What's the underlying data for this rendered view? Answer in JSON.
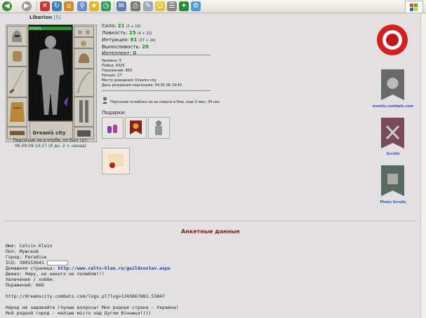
{
  "browser": {
    "toolbar_icons": [
      "back-icon",
      "forward-icon",
      "stop-icon",
      "refresh-icon",
      "home-icon",
      "search-icon",
      "favorites-icon",
      "history-icon",
      "mail-icon",
      "print-icon",
      "edit-icon",
      "messenger-icon",
      "research-icon",
      "bluetooth-icon"
    ]
  },
  "character": {
    "name": "Liberion",
    "level_tag": "[5]",
    "hp": "373/373",
    "city": "Dreams city",
    "location_line": "Персонаж не в клубе, но был тут:",
    "last_seen": "06.09.09 14:27 (4 дн. 2 ч. назад)"
  },
  "stats": {
    "strength_label": "Сила:",
    "strength_value": "21",
    "strength_bonus": "(5 + 16)",
    "agility_label": "Ловкость:",
    "agility_value": "25",
    "agility_bonus": "(4 + 21)",
    "intuition_label": "Интуиция:",
    "intuition_value": "61",
    "intuition_bonus": "(37 + 24)",
    "endurance_label": "Выносливость:",
    "endurance_value": "20",
    "intellect_label": "Интеллект:",
    "intellect_value": "0"
  },
  "info": {
    "level": "Уровень: 5",
    "wins": "Побед: 4325",
    "losses": "Поражений: 883",
    "draws": "Ничьих: 27",
    "birthplace": "Место рождения: Dreams city",
    "birthday": "День рождения персонажа: 04.05.08 19:43",
    "trauma_note": "Персонаж ослаблен из-за смерти в бою, еще 0 мин. 34 сек."
  },
  "gifts": {
    "label": "Подарки:"
  },
  "banners": {
    "events": "events.combats.com",
    "scrolls": "Scrolls",
    "photo": "Photo Scrolls"
  },
  "profile": {
    "section_title": "Анкетные данные",
    "name": "Имя: Calvin Klein",
    "gender": "Пол: Мужской",
    "city": "Город: Paradise",
    "icq": "ICQ: 388153641",
    "homepage_label": "Домашняя страница:",
    "homepage_url": "http://www.celts-klan.ru/guildsostav.aspx",
    "motto": "Девиз: Умру, но никого не полюблю!!!",
    "hobbies_label": "Увлечения / хобби:",
    "losses": "Поражений: 666",
    "log_url": "http://dreamscity.combats.com/logs.pl?log=1243667881.53847",
    "note1": "Народ не задавайте глупые вопросы! Моя родная страна - Украина!",
    "note2": "Мой родной город - маліше місто над Бугом Вінниця!)))"
  },
  "colors": {
    "background": "#e2e0e0",
    "stat_green": "#1d8a1d",
    "section_red": "#8b1a1a",
    "link_blue": "#1a3c9a",
    "banner_text": "#3355bb"
  }
}
